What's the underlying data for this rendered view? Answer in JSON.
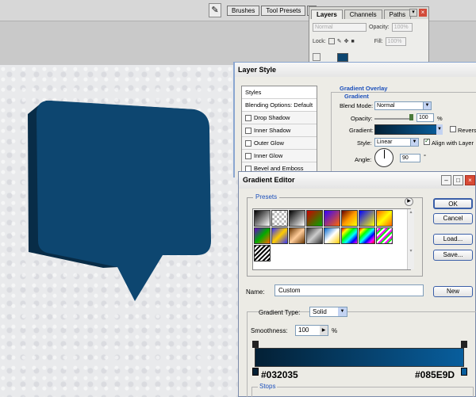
{
  "toolbar": {
    "brushes_tab": "Brushes",
    "tool_presets_tab": "Tool Presets"
  },
  "colors": {
    "shape_fill": "#0D4670",
    "shape_side": "#082C47",
    "gradient_start": "#032035",
    "gradient_end": "#085E9D"
  },
  "layers_panel": {
    "tabs": [
      "Layers",
      "Channels",
      "Paths"
    ],
    "blend_mode": "Normal",
    "opacity_label": "Opacity:",
    "opacity_value": "100%",
    "lock_label": "Lock:",
    "fill_label": "Fill:",
    "fill_value": "100%"
  },
  "layer_style": {
    "title": "Layer Style",
    "list": [
      "Styles",
      "Blending Options: Default",
      "Drop Shadow",
      "Inner Shadow",
      "Outer Glow",
      "Inner Glow",
      "Bevel and Emboss"
    ],
    "section_title": "Gradient Overlay",
    "group_title": "Gradient",
    "blend_mode_label": "Blend Mode:",
    "blend_mode_value": "Normal",
    "opacity_label": "Opacity:",
    "opacity_value": "100",
    "opacity_unit": "%",
    "gradient_label": "Gradient:",
    "reverse_label": "Reverse",
    "style_label": "Style:",
    "style_value": "Linear",
    "align_label": "Align with Layer",
    "angle_label": "Angle:",
    "angle_value": "90",
    "angle_unit": "°"
  },
  "gradient_editor": {
    "title": "Gradient Editor",
    "presets_label": "Presets",
    "buttons": {
      "ok": "OK",
      "cancel": "Cancel",
      "load": "Load...",
      "save": "Save...",
      "new": "New"
    },
    "name_label": "Name:",
    "name_value": "Custom",
    "gradient_type_label": "Gradient Type:",
    "gradient_type_value": "Solid",
    "smoothness_label": "Smoothness:",
    "smoothness_value": "100",
    "smoothness_unit": "%",
    "left_stop_hex": "#032035",
    "right_stop_hex": "#085E9D",
    "stops_label": "Stops"
  }
}
